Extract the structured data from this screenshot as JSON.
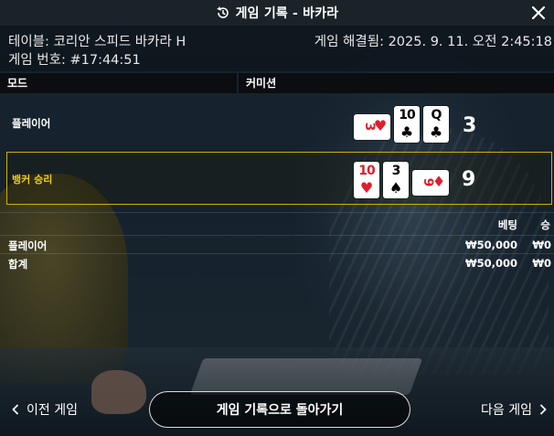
{
  "header": {
    "title": "게임 기록 - 바카라"
  },
  "info": {
    "table_name": "테이블: 코리안 스피드 바카라 H",
    "settled": "게임 해결됨: 2025. 9. 11. 오전 2:45:18",
    "game_number": "게임 번호: #17:44:51"
  },
  "columns": {
    "mode": "모드",
    "commission": "커미션"
  },
  "hands": {
    "player": {
      "label": "플레이어",
      "score": "3",
      "cards": [
        {
          "rank": "3",
          "suit": "♥",
          "color": "red",
          "orientation": "sideways"
        },
        {
          "rank": "10",
          "suit": "♣",
          "color": "black",
          "orientation": "upright"
        },
        {
          "rank": "Q",
          "suit": "♣",
          "color": "black",
          "orientation": "upright"
        }
      ]
    },
    "banker": {
      "label": "뱅커 승리",
      "score": "9",
      "cards": [
        {
          "rank": "10",
          "suit": "♥",
          "color": "red",
          "orientation": "upright"
        },
        {
          "rank": "3",
          "suit": "♠",
          "color": "black",
          "orientation": "upright"
        },
        {
          "rank": "9",
          "suit": "♦",
          "color": "red",
          "orientation": "sideways"
        }
      ],
      "highlight_color": "#d1b100"
    }
  },
  "bets": {
    "headers": {
      "bet": "베팅",
      "win": "승"
    },
    "rows": [
      {
        "name": "플레이어",
        "amount": "₩50,000",
        "win": "₩0"
      }
    ],
    "total": {
      "name": "합계",
      "amount": "₩50,000",
      "win": "₩0"
    }
  },
  "footer": {
    "prev": "이전 게임",
    "back": "게임 기록으로 돌아가기",
    "next": "다음 게임"
  },
  "icons": {
    "history": "history-icon",
    "close": "close-icon",
    "prev": "chevron-left-icon",
    "next": "chevron-right-icon"
  }
}
